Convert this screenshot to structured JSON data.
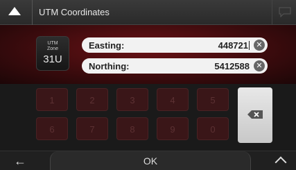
{
  "header": {
    "title": "UTM Coordinates"
  },
  "zone": {
    "caption_line1": "UTM",
    "caption_line2": "Zone",
    "value": "31U"
  },
  "fields": {
    "easting": {
      "label": "Easting:",
      "value": "448721"
    },
    "northing": {
      "label": "Northing:",
      "value": "5412588"
    }
  },
  "keypad": {
    "keys": [
      "1",
      "2",
      "3",
      "4",
      "5",
      "6",
      "7",
      "8",
      "9",
      "0"
    ]
  },
  "footer": {
    "back": "←",
    "ok": "OK"
  },
  "colors": {
    "accent": "#6a1216",
    "field_bg": "#f2f2f2"
  }
}
